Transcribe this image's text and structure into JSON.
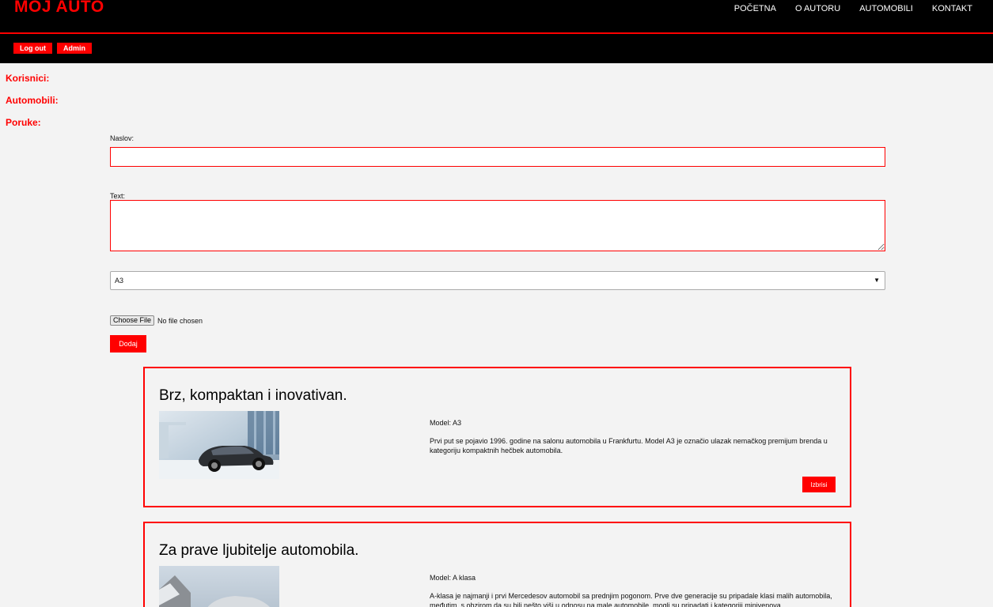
{
  "header": {
    "brand": "MOJ AUTO",
    "nav": [
      "POČETNA",
      "O AUTORU",
      "AUTOMOBILI",
      "KONTAKT"
    ],
    "logout_label": "Log out",
    "admin_label": "Admin"
  },
  "sidebar": {
    "items": [
      "Korisnici:",
      "Automobili:",
      "Poruke:"
    ]
  },
  "form": {
    "title_label": "Naslov:",
    "title_value": "",
    "text_label": "Text:",
    "text_value": "",
    "model_selected": "A3",
    "file_button": "Choose File",
    "file_status": "No file chosen",
    "submit_label": "Dodaj"
  },
  "posts": [
    {
      "title": "Brz, kompaktan i inovativan.",
      "model": "Model: A3",
      "description": "Prvi put se pojavio 1996. godine na salonu automobila u Frankfurtu. Model A3 je označio ulazak nemačkog premijum brenda u kategoriju kompaktnih hečbek automobila.",
      "delete_label": "Izbrisi"
    },
    {
      "title": "Za prave ljubitelje automobila.",
      "model": "Model: A klasa",
      "description": "A-klasa je najmanji i prvi Mercedesov automobil sa prednjim pogonom. Prve dve generacije su pripadale klasi malih automobila, međutim, s obzirom da su bili nešto viši u odnosu na male automobile, mogli su pripadati i kategoriji minivenova."
    }
  ]
}
